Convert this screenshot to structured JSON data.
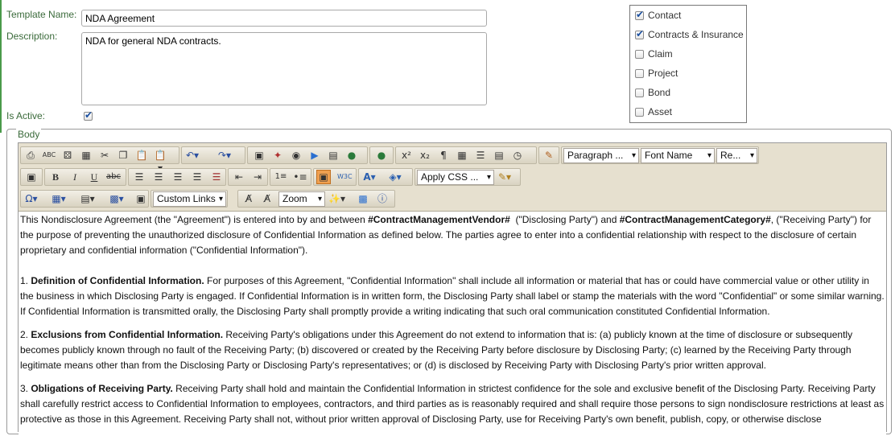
{
  "form": {
    "template_name_label": "Template Name:",
    "template_name_value": "NDA Agreement",
    "description_label": "Description:",
    "description_value": "NDA for general NDA contracts.",
    "is_active_label": "Is Active:",
    "is_active": true,
    "body_legend": "Body"
  },
  "modules": [
    {
      "label": "Contact",
      "checked": true
    },
    {
      "label": "Contracts & Insurance",
      "checked": true
    },
    {
      "label": "Claim",
      "checked": false
    },
    {
      "label": "Project",
      "checked": false
    },
    {
      "label": "Bond",
      "checked": false
    },
    {
      "label": "Asset",
      "checked": false
    }
  ],
  "toolbar": {
    "paragraph_select": "Paragraph ...",
    "font_name_select": "Font Name",
    "size_select": "Re...",
    "apply_css_select": "Apply CSS ...",
    "custom_links_select": "Custom Links",
    "zoom_select": "Zoom",
    "icons": [
      "print-icon",
      "spellcheck-icon",
      "find-icon",
      "select-all-icon",
      "cut-icon",
      "copy-icon",
      "paste-icon",
      "paste-special-icon",
      "undo-icon",
      "redo-icon",
      "image-icon",
      "flash-icon",
      "link-icon",
      "media-icon",
      "document-icon",
      "template-icon",
      "hyperlink-icon",
      "superscript-icon",
      "subscript-icon",
      "show-formatting-icon",
      "insert-table-icon",
      "horizontal-rule-icon",
      "insert-date-icon",
      "insert-time-icon",
      "format-painter-icon",
      "image-manager-icon",
      "bold-icon",
      "italic-icon",
      "underline-icon",
      "strikethrough-icon",
      "align-left-icon",
      "align-center-icon",
      "align-right-icon",
      "justify-icon",
      "remove-alignment-icon",
      "outdent-icon",
      "indent-icon",
      "numbered-list-icon",
      "bulleted-list-icon",
      "toggle-border-icon",
      "xhtml-validator-icon",
      "font-color-icon",
      "highlight-icon",
      "css-class-icon",
      "symbol-icon",
      "table-icon",
      "paragraph-icon",
      "snippet-icon",
      "image-map-icon",
      "formatting-icon",
      "strip-format-icon",
      "module-manager-icon",
      "property-icon",
      "about-icon"
    ]
  },
  "body": {
    "intro_a": "This Nondisclosure Agreement (the \"Agreement\") is entered into by and between ",
    "vendor_token": "#ContractManagementVendor#",
    "intro_b": "  (\"Disclosing Party\") and ",
    "category_token": "#ContractManagementCategory#",
    "intro_c": ", (\"Receiving Party\") for the purpose of preventing the unauthorized disclosure of Confidential Information as defined below. The parties agree to enter into a confidential relationship with respect to the disclosure of certain proprietary and confidential information (\"Confidential Information\").",
    "s1_num": "1. ",
    "s1_title": "Definition of Confidential Information.",
    "s1_text": " For purposes of this Agreement, \"Confidential Information\" shall include all information or material that has or could have commercial value or other utility in the business in which Disclosing Party is engaged. If Confidential Information is in written form, the Disclosing Party shall label or stamp the materials with the word \"Confidential\" or some similar warning. If Confidential Information is transmitted orally, the Disclosing Party shall promptly provide a writing indicating that such oral communication constituted Confidential Information.",
    "s2_num": "2. ",
    "s2_title": "Exclusions from Confidential Information.",
    "s2_text": " Receiving Party's obligations under this Agreement do not extend to information that is: (a) publicly known at the time of disclosure or subsequently becomes publicly known through no fault of the Receiving Party; (b) discovered or created by the Receiving Party before disclosure by Disclosing Party; (c) learned by the Receiving Party through legitimate means other than from the Disclosing Party or Disclosing Party's representatives; or (d) is disclosed by Receiving Party with Disclosing Party's prior written approval.",
    "s3_num": "3. ",
    "s3_title": "Obligations of Receiving Party.",
    "s3_text": " Receiving Party shall hold and maintain the Confidential Information in strictest confidence for the sole and exclusive benefit of the Disclosing Party. Receiving Party shall carefully restrict access to Confidential Information to employees, contractors, and third parties as is reasonably required and shall require those persons to sign nondisclosure restrictions at least as protective as those in this Agreement. Receiving Party shall not, without prior written approval of Disclosing Party, use for Receiving Party's own benefit, publish, copy, or otherwise disclose"
  }
}
